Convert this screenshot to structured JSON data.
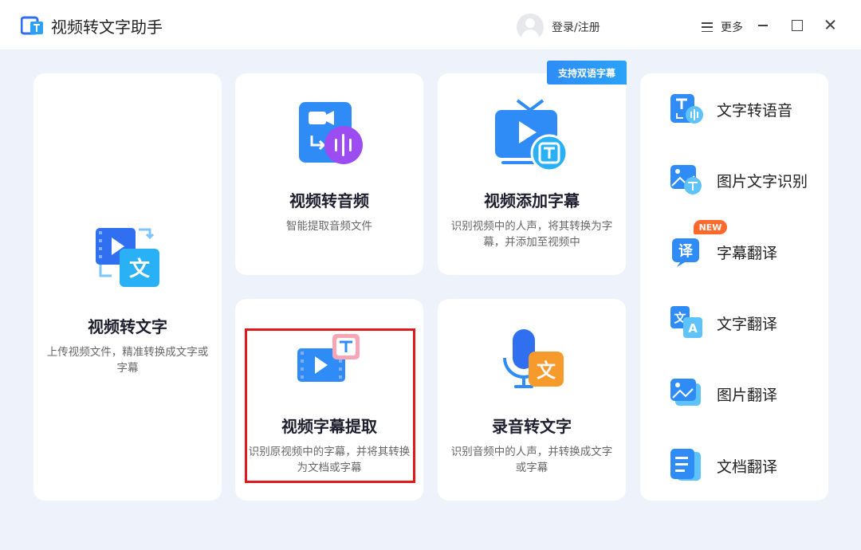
{
  "app": {
    "title": "视频转文字助手"
  },
  "header": {
    "login_label": "登录/注册",
    "menu_label": "更多"
  },
  "cards": {
    "video_to_text": {
      "title": "视频转文字",
      "desc": "上传视频文件，精准转换成文字或字幕"
    },
    "video_to_audio": {
      "title": "视频转音频",
      "desc": "智能提取音频文件"
    },
    "add_subtitle": {
      "title": "视频添加字幕",
      "desc": "识别视频中的人声，将其转换为字幕，并添加至视频中",
      "ribbon": "支持双语字幕"
    },
    "extract_subtitle": {
      "title": "视频字幕提取",
      "desc": "识别原视频中的字幕，并将其转换为文档或字幕"
    },
    "record_to_text": {
      "title": "录音转文字",
      "desc": "识别音频中的人声，并转换成文字或字幕"
    }
  },
  "tools": [
    {
      "label": "文字转语音",
      "icon": "text-to-speech-icon"
    },
    {
      "label": "图片文字识别",
      "icon": "image-ocr-icon"
    },
    {
      "label": "字幕翻译",
      "icon": "subtitle-translate-icon",
      "badge": "NEW"
    },
    {
      "label": "文字翻译",
      "icon": "text-translate-icon"
    },
    {
      "label": "图片翻译",
      "icon": "image-translate-icon"
    },
    {
      "label": "文档翻译",
      "icon": "document-translate-icon"
    }
  ],
  "colors": {
    "accent": "#2f8cf6",
    "highlight": "#e01a1a",
    "badge": "#ff6a2c",
    "background": "#eef3fb"
  }
}
